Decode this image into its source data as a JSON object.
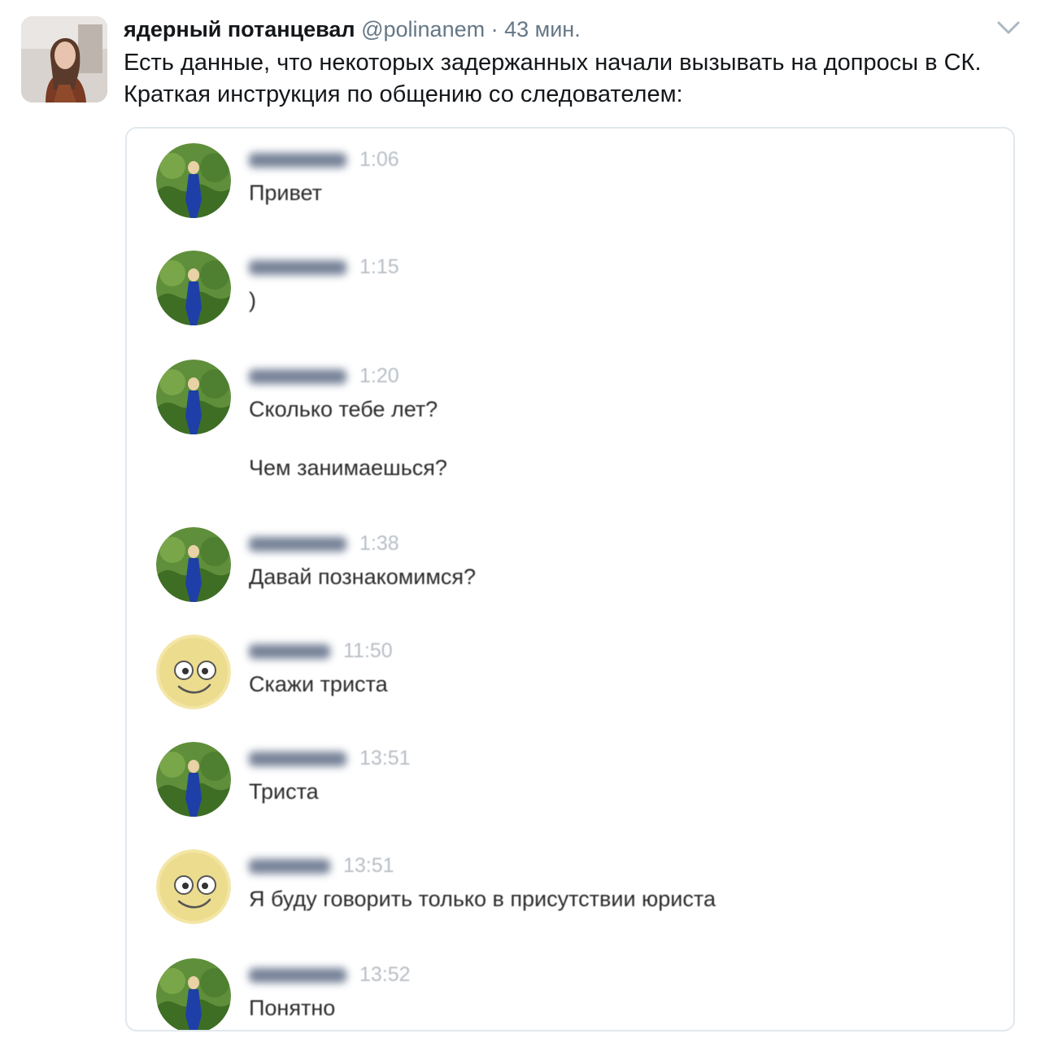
{
  "tweet": {
    "author_name": "ядерный потанцевал",
    "handle": "@polinanem",
    "separator": "·",
    "time": "43 мин.",
    "text": "Есть данные, что некоторых задержанных начали вызывать на допросы в СК. Краткая инструкция по общению со следователем:",
    "menu_icon": "chevron-down-icon"
  },
  "chat": {
    "messages": [
      {
        "avatar": "woman-in-blue-dress-avatar",
        "time": "1:06",
        "text": "Привет"
      },
      {
        "avatar": "woman-in-blue-dress-avatar",
        "time": "1:15",
        "text": ")"
      },
      {
        "avatar": "woman-in-blue-dress-avatar",
        "time": "1:20",
        "text": "Сколько тебе лет?",
        "text2": "Чем занимаешься?"
      },
      {
        "avatar": "woman-in-blue-dress-avatar",
        "time": "1:38",
        "text": "Давай познакомимся?"
      },
      {
        "avatar": "smiley-face-avatar",
        "time": "11:50",
        "text": "Скажи триста"
      },
      {
        "avatar": "woman-in-blue-dress-avatar",
        "time": "13:51",
        "text": "Триста"
      },
      {
        "avatar": "smiley-face-avatar",
        "time": "13:51",
        "text": "Я буду говорить только в присутствии юриста"
      },
      {
        "avatar": "woman-in-blue-dress-avatar",
        "time": "13:52",
        "text": "Понятно"
      }
    ]
  },
  "colors": {
    "link_gray": "#657786",
    "border": "#e1e8ed",
    "timestamp": "#b8bec6"
  }
}
